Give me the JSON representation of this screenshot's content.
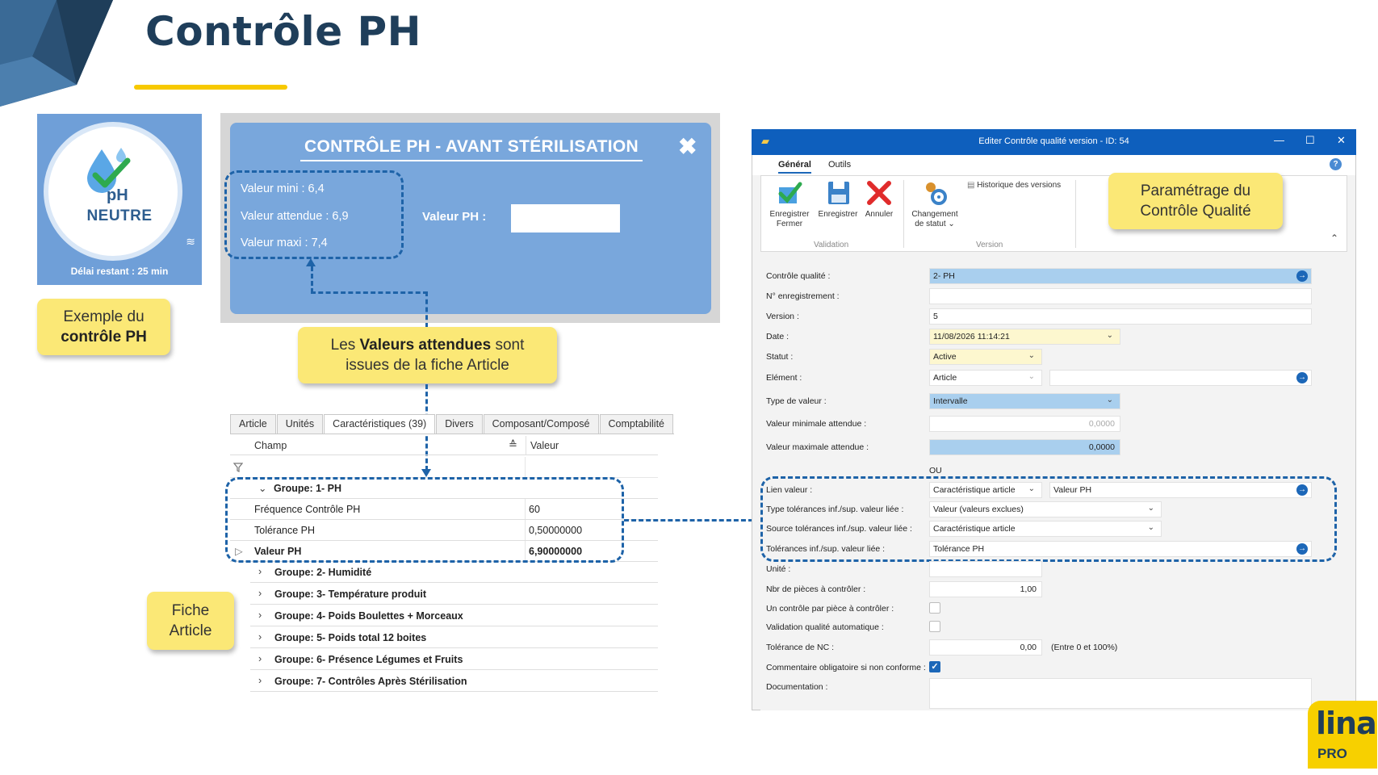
{
  "slide": {
    "title": "Contrôle PH",
    "colors": {
      "title": "#1f3e5a",
      "accent_yellow": "#f7c900",
      "dashed_blue": "#1e63a8",
      "panel_blue": "#79a7dc"
    }
  },
  "app_icon": {
    "ph": "pH",
    "neutre": "NEUTRE",
    "delay": "Délai restant : 25 min",
    "icons": [
      "water-drop-check-icon",
      "wave-icon"
    ]
  },
  "callouts": {
    "exemple": {
      "line1": "Exemple du",
      "line2": "contrôle PH"
    },
    "valeurs": {
      "pre": "Les ",
      "bold": "Valeurs attendues",
      "post": " sont",
      "line2": "issues de la fiche Article"
    },
    "fiche": {
      "line1": "Fiche",
      "line2": "Article"
    },
    "parametrage": {
      "line1": "Paramétrage du",
      "line2": "Contrôle Qualité"
    }
  },
  "ph_dialog": {
    "title": "CONTRÔLE PH - AVANT STÉRILISATION",
    "close": "✖",
    "valeur_mini": "Valeur mini : 6,4",
    "valeur_attendue": "Valeur attendue : 6,9",
    "valeur_maxi": "Valeur maxi : 7,4",
    "valeur_ph_label": "Valeur PH :",
    "valeur_ph_value": ""
  },
  "article_grid": {
    "tabs": [
      "Article",
      "Unités",
      "Caractéristiques (39)",
      "Divers",
      "Composant/Composé",
      "Comptabilité"
    ],
    "active_tab": "Caractéristiques (39)",
    "headers": {
      "champ": "Champ",
      "valeur": "Valeur",
      "sort_icon": "≙"
    },
    "group1": "Groupe: 1- PH",
    "rows": [
      {
        "champ": "Fréquence Contrôle PH",
        "valeur": "60"
      },
      {
        "champ": "Tolérance PH",
        "valeur": "0,50000000"
      },
      {
        "champ": "Valeur PH",
        "valeur": "6,90000000"
      }
    ],
    "groups": [
      "Groupe: 2- Humidité",
      "Groupe: 3- Température produit",
      "Groupe: 4- Poids Boulettes + Morceaux",
      "Groupe: 5- Poids total 12 boites",
      "Groupe: 6- Présence Légumes et Fruits",
      "Groupe: 7- Contrôles Après Stérilisation"
    ]
  },
  "edit_window": {
    "title": "Editer Contrôle qualité version - ID: 54",
    "controls": {
      "minimize": "—",
      "maximize": "☐",
      "close": "✕"
    },
    "ribbon_tabs": [
      "Général",
      "Outils"
    ],
    "ribbon": {
      "save_close": [
        "Enregistrer",
        "Fermer"
      ],
      "save": "Enregistrer",
      "cancel": "Annuler",
      "change_status": [
        "Changement",
        "de statut ⌄"
      ],
      "history": "Historique des versions",
      "group_validation": "Validation",
      "group_version": "Version"
    },
    "form": {
      "controle_qualite": {
        "label": "Contrôle qualité :",
        "value": "2- PH"
      },
      "num_enregistrement": {
        "label": "N° enregistrement :",
        "value": ""
      },
      "version": {
        "label": "Version :",
        "value": "5"
      },
      "date": {
        "label": "Date :",
        "value": "11/08/2026 11:14:21"
      },
      "statut": {
        "label": "Statut :",
        "value": "Active"
      },
      "element": {
        "label": "Elément :",
        "value": "Article",
        "value2": ""
      },
      "type_valeur": {
        "label": "Type de valeur :",
        "value": "Intervalle"
      },
      "val_min": {
        "label": "Valeur minimale attendue :",
        "value": "0,0000"
      },
      "val_max": {
        "label": "Valeur maximale attendue :",
        "value": "0,0000"
      },
      "ou": "OU",
      "lien_valeur": {
        "label": "Lien valeur :",
        "value": "Caractéristique article",
        "value2": "Valeur PH"
      },
      "type_tol": {
        "label": "Type tolérances inf./sup. valeur liée :",
        "value": "Valeur (valeurs exclues)"
      },
      "source_tol": {
        "label": "Source tolérances inf./sup. valeur liée :",
        "value": "Caractéristique article"
      },
      "tol_inf_sup": {
        "label": "Tolérances inf./sup. valeur liée :",
        "value": "Tolérance PH"
      },
      "unite": {
        "label": "Unité :",
        "value": ""
      },
      "nbr_pieces": {
        "label": "Nbr de pièces à contrôler :",
        "value": "1,00"
      },
      "un_controle": {
        "label": "Un contrôle par pièce à contrôler :",
        "checked": false
      },
      "validation_auto": {
        "label": "Validation qualité automatique :",
        "checked": false
      },
      "tolerance_nc": {
        "label": "Tolérance de NC :",
        "value": "0,00",
        "hint": "(Entre 0 et 100%)"
      },
      "commentaire": {
        "label": "Commentaire obligatoire si non conforme :",
        "checked": true
      },
      "documentation": {
        "label": "Documentation :",
        "value": ""
      }
    }
  },
  "logo": {
    "name": "lina",
    "sub": "PRO"
  }
}
